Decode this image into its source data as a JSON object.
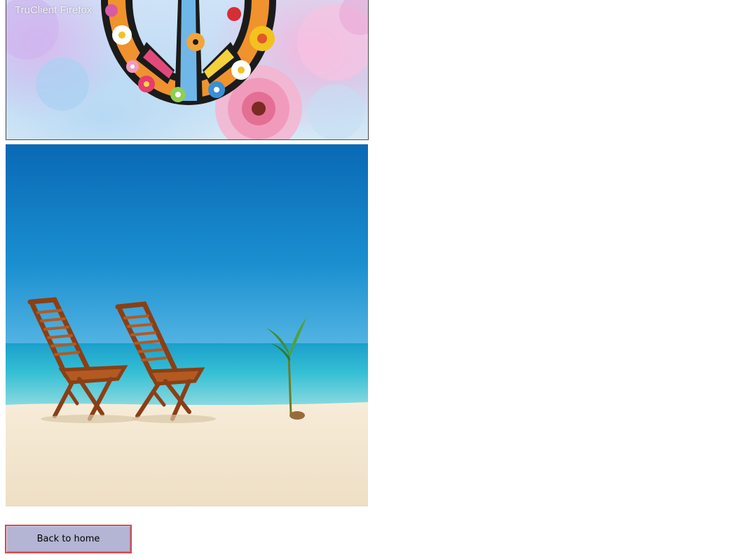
{
  "banner": {
    "caption": "TruClient Firefox",
    "image_icon": "floral-peace-sign-image"
  },
  "beach_photo": {
    "image_icon": "beach-chairs-image"
  },
  "actions": {
    "back_label": "Back to home"
  },
  "colors": {
    "button_fill": "#b4b4d4",
    "button_border": "#d94a4a",
    "sky_top": "#0a6db8",
    "sea": "#2fb9d1",
    "sand": "#f3e6cf"
  }
}
